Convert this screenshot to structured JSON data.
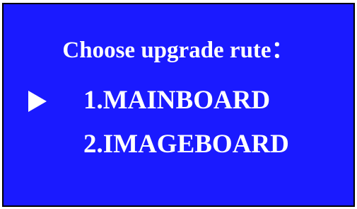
{
  "title": "Choose upgrade rute：",
  "menu": {
    "items": [
      {
        "label": "1.MAINBOARD",
        "selected": true
      },
      {
        "label": "2.IMAGEBOARD",
        "selected": false
      }
    ],
    "cursor_icon": "right-triangle-pointer"
  },
  "colors": {
    "background": "#1a1aff",
    "text": "#ffffff",
    "border": "#000000"
  }
}
